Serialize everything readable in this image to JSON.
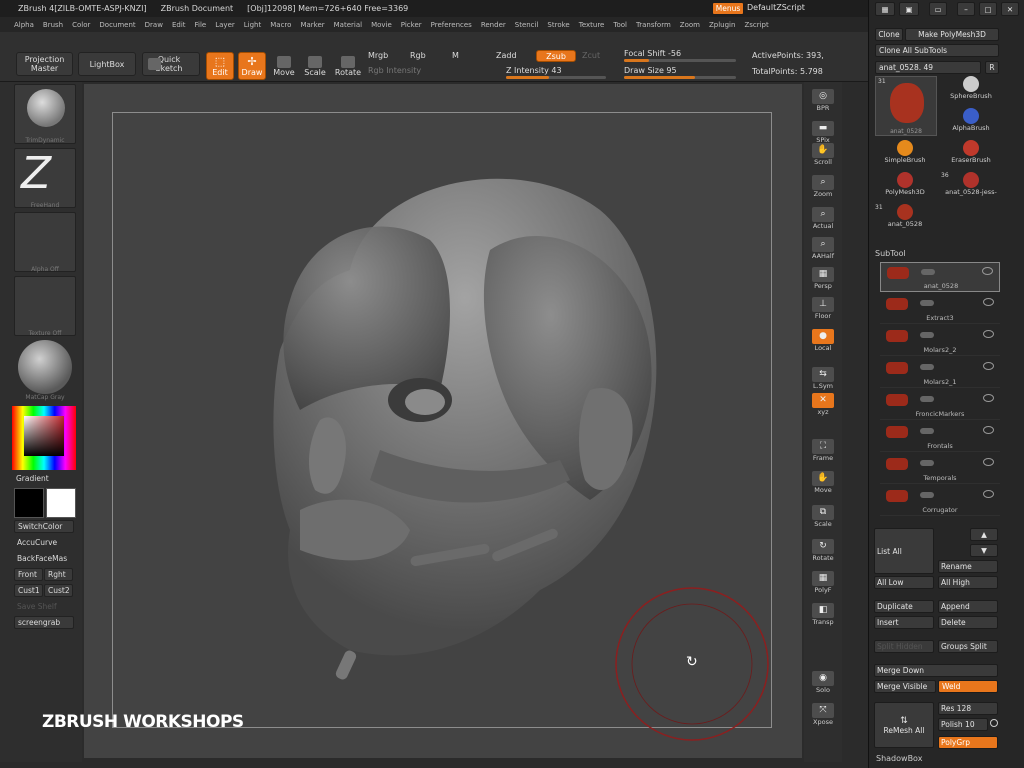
{
  "titlebar": {
    "app": "ZBrush 4[ZILB-OMTE-ASPJ-KNZI]",
    "document": "ZBrush Document",
    "stats": "[Obj]12098] Mem=726+640 Free=3369"
  },
  "topright": {
    "menus": "Menus",
    "zscript": "DefaultZScript"
  },
  "menubar": [
    "Alpha",
    "Brush",
    "Color",
    "Document",
    "Draw",
    "Edit",
    "File",
    "Layer",
    "Light",
    "Macro",
    "Marker",
    "Material",
    "Movie",
    "Picker",
    "Preferences",
    "Render",
    "Stencil",
    "Stroke",
    "Texture",
    "Tool",
    "Transform",
    "Zoom",
    "Zplugin",
    "Zscript"
  ],
  "toolbar": {
    "projection_master": "Projection Master",
    "lightbox": "LightBox",
    "quick_sketch": "Quick Sketch",
    "edit": "Edit",
    "draw": "Draw",
    "move": "Move",
    "scale": "Scale",
    "rotate": "Rotate",
    "mrgb": "Mrgb",
    "rgb": "Rgb",
    "m": "M",
    "rgb_intensity": "Rgb Intensity",
    "zadd": "Zadd",
    "zsub": "Zsub",
    "zcut": "Zcut",
    "z_intensity": "Z Intensity 43",
    "z_intensity_value": 43,
    "focal_shift": "Focal Shift -56",
    "focal_shift_value": -56,
    "draw_size": "Draw Size 95",
    "draw_size_value": 95,
    "active_points": "ActivePoints: 393,",
    "total_points": "TotalPoints: 5.798"
  },
  "leftshelf": {
    "brush_label": "TrimDynamic",
    "stroke_label": "FreeHand",
    "alpha_label": "Alpha Off",
    "texture_label": "Texture Off",
    "material_label": "MatCap Gray",
    "gradient": "Gradient",
    "switchcolor": "SwitchColor",
    "accucurve": "AccuCurve",
    "backfacemask": "BackFaceMas",
    "front": "Front",
    "right": "Rght",
    "cust1": "Cust1",
    "cust2": "Cust2",
    "save_shelf": "Save Shelf",
    "screengrab": "screengrab"
  },
  "rightshelf": [
    {
      "label": "BPR",
      "icon": "render-icon"
    },
    {
      "label": "SPix",
      "icon": "spix-icon"
    },
    {
      "label": "Scroll",
      "icon": "hand-icon"
    },
    {
      "label": "Zoom",
      "icon": "zoom-icon"
    },
    {
      "label": "Actual",
      "icon": "actual-icon"
    },
    {
      "label": "AAHalf",
      "icon": "aahalf-icon"
    },
    {
      "label": "Persp",
      "icon": "perspective-icon"
    },
    {
      "label": "Floor",
      "icon": "floor-icon"
    },
    {
      "label": "Local",
      "icon": "local-icon"
    },
    {
      "label": "L.Sym",
      "icon": "symmetry-icon"
    },
    {
      "label": "xyz",
      "icon": "xyz-icon"
    },
    {
      "label": "Frame",
      "icon": "frame-icon"
    },
    {
      "label": "Move",
      "icon": "move-hand-icon"
    },
    {
      "label": "Scale",
      "icon": "scale-icon"
    },
    {
      "label": "Rotate",
      "icon": "rotate-icon"
    },
    {
      "label": "PolyF",
      "icon": "polyframe-icon"
    },
    {
      "label": "Transp",
      "icon": "transparency-icon"
    },
    {
      "label": "Solo",
      "icon": "solo-icon"
    },
    {
      "label": "Xpose",
      "icon": "xpose-icon"
    }
  ],
  "toolpanel": {
    "clone": "Clone",
    "make_polymesh": "Make PolyMesh3D",
    "clone_all": "Clone All SubTools",
    "current_tool": "anat_0528. 49",
    "r": "R",
    "tools": [
      {
        "name": "anat_0528",
        "count": "31"
      },
      {
        "name": "SphereBrush",
        "count": ""
      },
      {
        "name": "AlphaBrush",
        "count": ""
      },
      {
        "name": "SimpleBrush",
        "count": ""
      },
      {
        "name": "EraserBrush",
        "count": ""
      },
      {
        "name": "PolyMesh3D",
        "count": ""
      },
      {
        "name": "anat_0528-jess-",
        "count": "36"
      },
      {
        "name": "anat_0528",
        "count": "31"
      }
    ]
  },
  "subtool": {
    "title": "SubTool",
    "items": [
      "anat_0528",
      "Extract3",
      "Molars2_2",
      "Molars2_1",
      "FroncicMarkers",
      "Frontals",
      "Temporals",
      "Corrugator"
    ],
    "list_all": "List All",
    "rename": "Rename",
    "all_low": "All Low",
    "all_high": "All High",
    "duplicate": "Duplicate",
    "append": "Append",
    "insert": "Insert",
    "delete": "Delete",
    "split_hidden": "Split Hidden",
    "groups_split": "Groups Split",
    "merge_down": "Merge Down",
    "merge_visible": "Merge Visible",
    "weld": "Weld",
    "remesh_all": "ReMesh All",
    "res": "Res 128",
    "polish": "Polish 10",
    "polygrp": "PolyGrp",
    "shadowbox": "ShadowBox"
  },
  "watermark": "ZBRUSH WORKSHOPS",
  "colors": {
    "accent": "#e8761c",
    "bg": "#2b2b2b",
    "canvas": "#434343"
  }
}
